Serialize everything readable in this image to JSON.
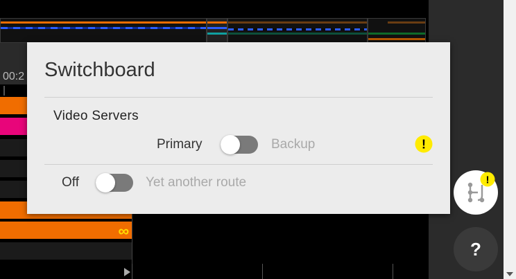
{
  "timeline": {
    "ruler_time": "00:2",
    "infinity_glyph": "∞"
  },
  "switchboard": {
    "title": "Switchboard",
    "section_title": "Video Servers",
    "route1": {
      "left_label": "Primary",
      "right_label": "Backup",
      "state": "off",
      "warning_symbol": "!"
    },
    "route2": {
      "left_label": "Off",
      "right_label": "Yet another route",
      "state": "off"
    }
  },
  "rail": {
    "help_label": "?",
    "switch_warning_symbol": "!"
  },
  "colors": {
    "accent_orange": "#f06d00",
    "accent_pink": "#e8057a",
    "warning_yellow": "#ffeb00",
    "panel_bg": "#ececec",
    "toggle_track": "#7a7a7a"
  },
  "icons": {
    "warning": "warning-icon",
    "switchboard": "switchboard-icon",
    "help": "help-icon",
    "infinity": "infinity-icon",
    "play_marker": "play-marker-icon",
    "scroll_down": "scroll-down-icon"
  }
}
